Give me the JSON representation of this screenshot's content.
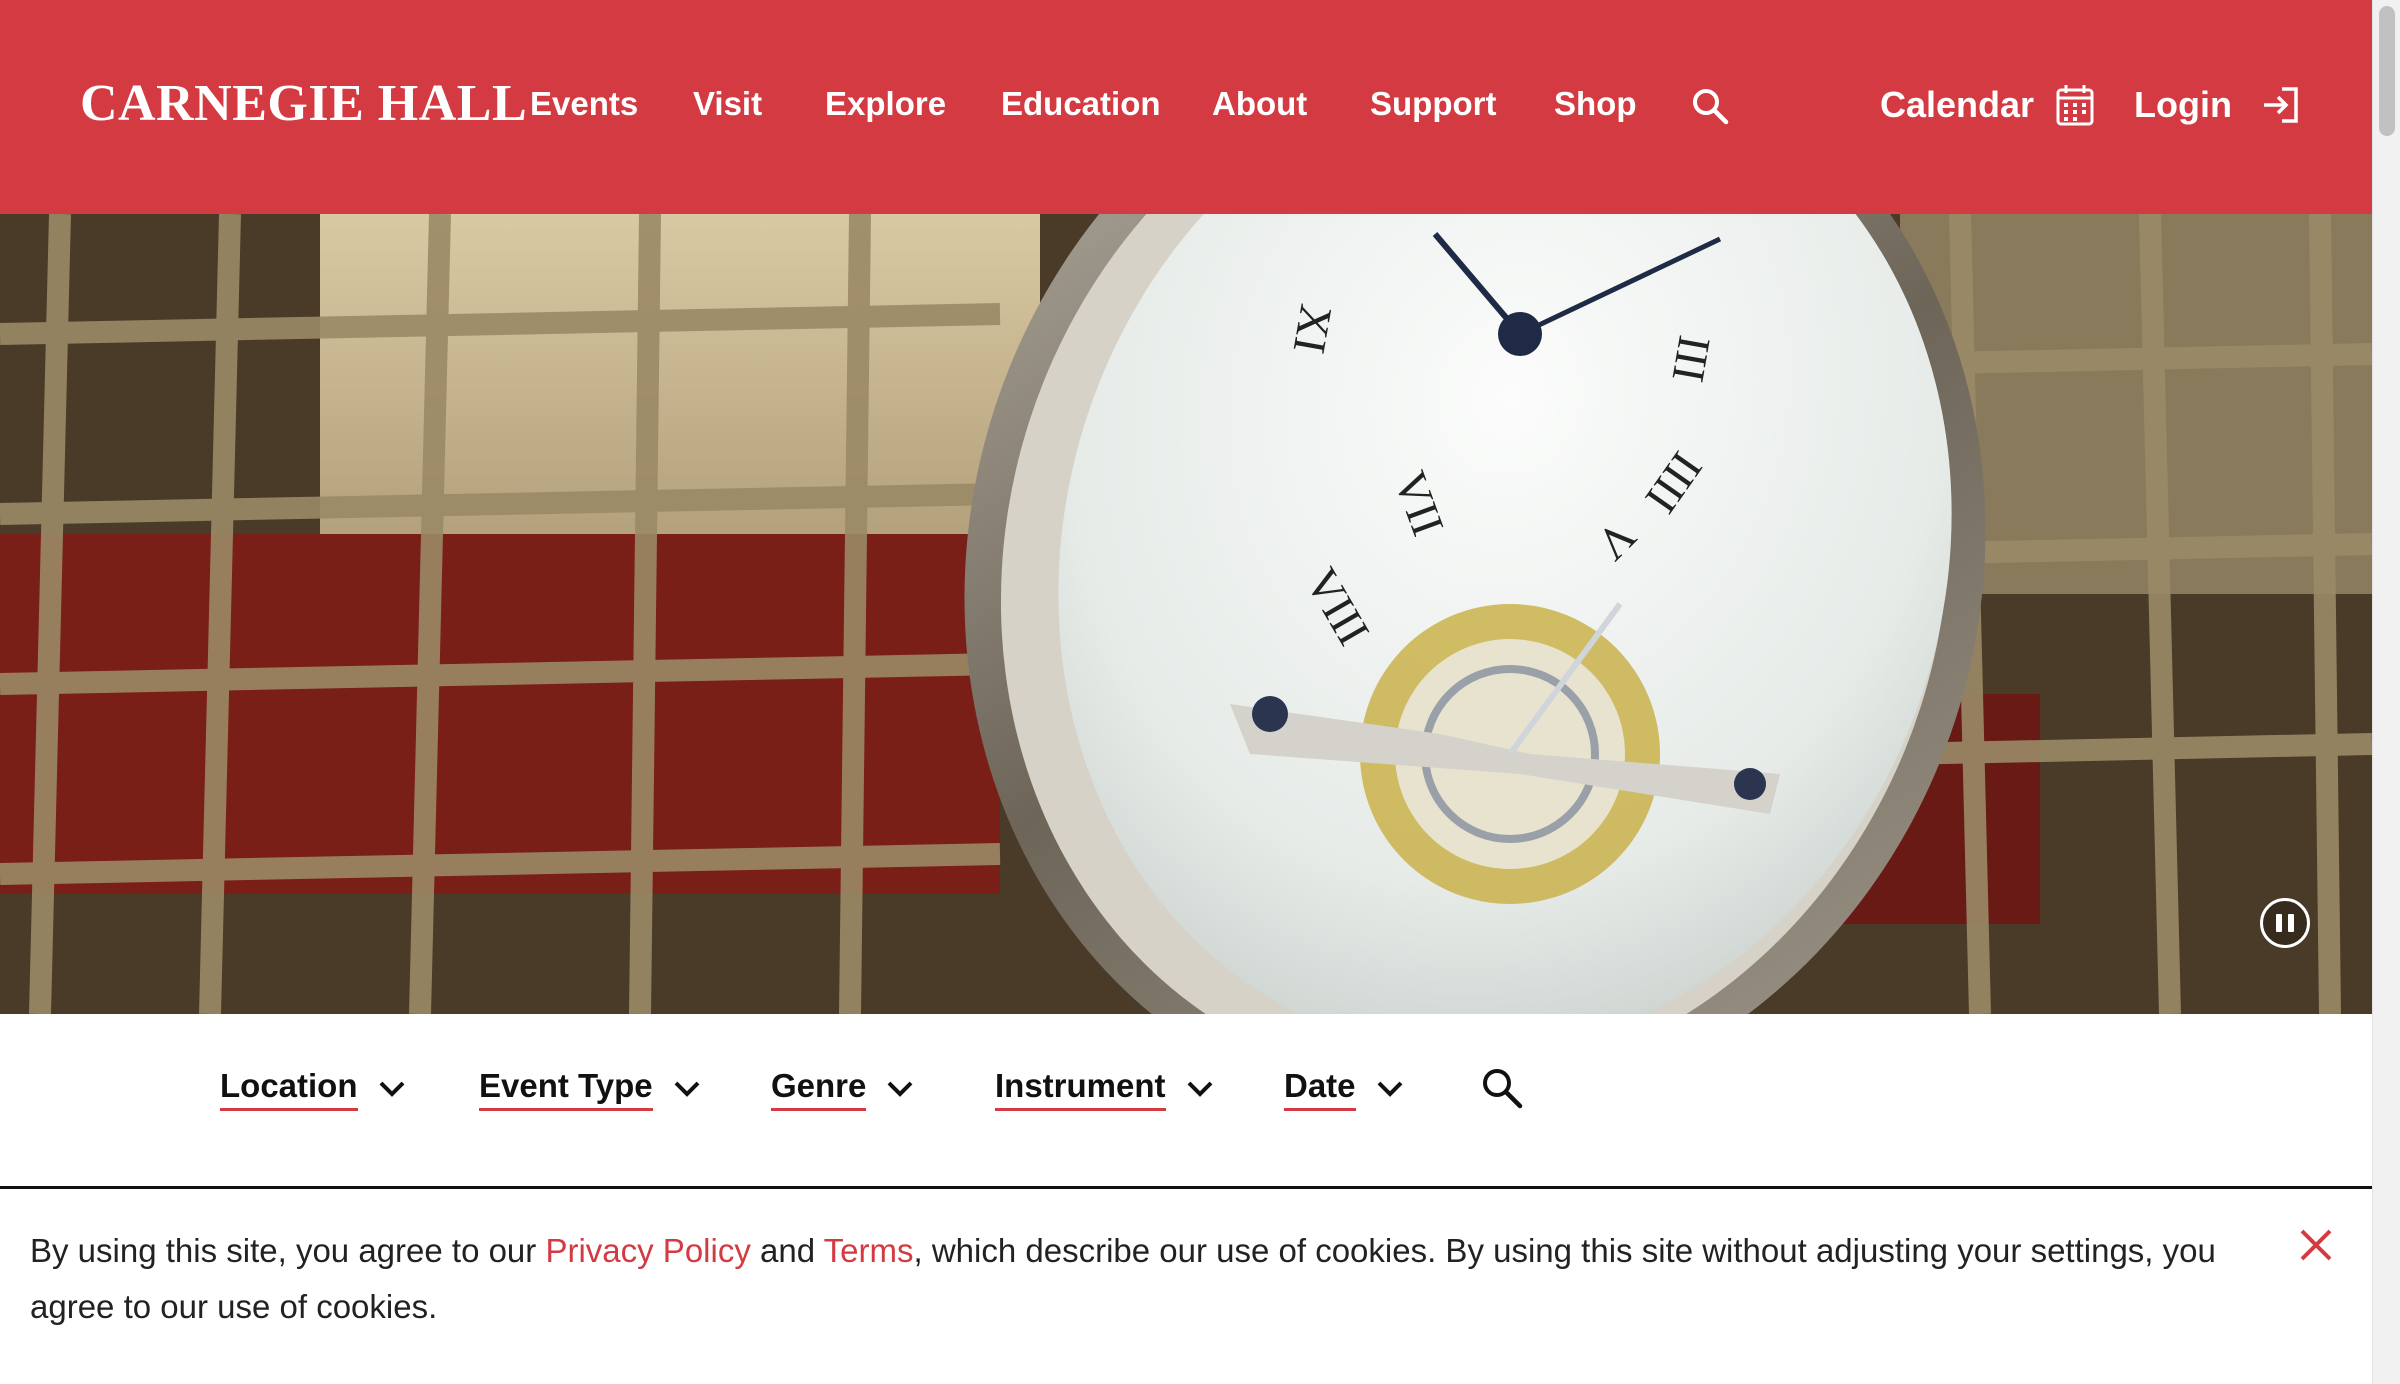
{
  "colors": {
    "brand_red": "#d33a41",
    "text_dark": "#111111",
    "white": "#ffffff"
  },
  "header": {
    "logo": "CARNEGIE HALL",
    "nav": [
      "Events",
      "Visit",
      "Explore",
      "Education",
      "About",
      "Support",
      "Shop"
    ],
    "search_icon": "search-icon",
    "calendar_label": "Calendar",
    "calendar_icon": "calendar-icon",
    "login_label": "Login",
    "login_icon": "login-icon"
  },
  "hero": {
    "media": "video",
    "pause_icon": "pause-icon"
  },
  "filters": {
    "items": [
      "Location",
      "Event Type",
      "Genre",
      "Instrument",
      "Date"
    ],
    "chevron_icon": "chevron-down-icon",
    "search_icon": "search-icon"
  },
  "cookie_banner": {
    "text_1": "By using this site, you agree to our ",
    "privacy_link": "Privacy Policy",
    "text_2": " and ",
    "terms_link": "Terms",
    "text_3": ", which describe our use of cookies. By using this site without adjusting your settings, you agree to our use of cookies.",
    "close_icon": "close-icon"
  }
}
